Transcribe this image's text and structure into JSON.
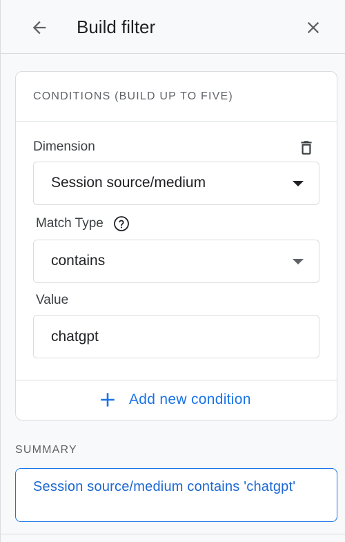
{
  "header": {
    "title": "Build filter",
    "back_icon": "arrow-back-icon",
    "close_icon": "close-icon"
  },
  "conditions": {
    "heading": "CONDITIONS (BUILD UP TO FIVE)",
    "dimension": {
      "label": "Dimension",
      "value": "Session source/medium",
      "delete_icon": "trash-icon"
    },
    "match_type": {
      "label": "Match Type",
      "value": "contains",
      "help_icon": "help-circle-icon"
    },
    "value_field": {
      "label": "Value",
      "value": "chatgpt"
    },
    "add_condition_label": "Add new condition"
  },
  "summary": {
    "heading": "SUMMARY",
    "text": "Session source/medium contains 'chatgpt'"
  },
  "colors": {
    "accent": "#1a73e8",
    "text_secondary": "#5f6368",
    "border": "#dadce0",
    "background": "#f8f9fa"
  }
}
